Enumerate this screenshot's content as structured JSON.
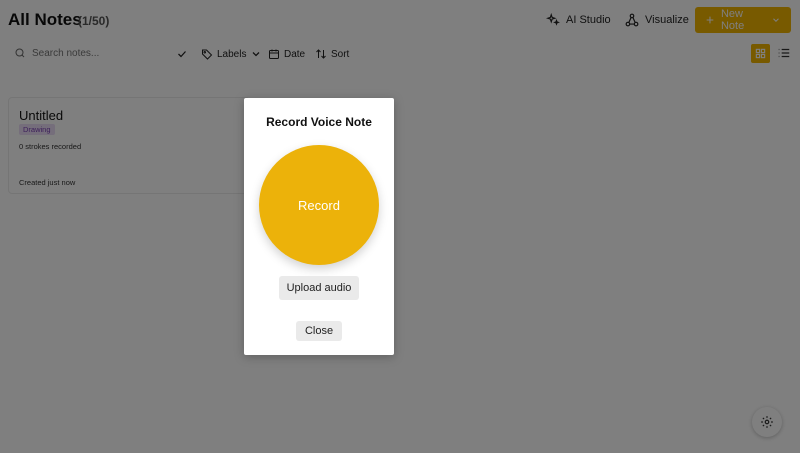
{
  "header": {
    "title": "All Notes",
    "count": "(1/50)",
    "ai_studio_label": "AI Studio",
    "visualize_label": "Visualize",
    "new_note_label": "New Note"
  },
  "toolbar": {
    "search_placeholder": "Search notes...",
    "labels_label": "Labels",
    "date_label": "Date",
    "sort_label": "Sort"
  },
  "notes": [
    {
      "title": "Untitled",
      "badge": "Drawing",
      "meta": "0 strokes recorded",
      "created": "Created just now"
    }
  ],
  "modal": {
    "title": "Record Voice Note",
    "record_label": "Record",
    "upload_label": "Upload audio",
    "close_label": "Close"
  },
  "colors": {
    "accent": "#f0b400",
    "record": "#ecb20a",
    "badge_text": "#7b3fb5",
    "badge_bg": "#eadcf6"
  },
  "icons": {
    "ai_studio": "sparkles-icon",
    "visualize": "network-icon",
    "new_note": "plus-icon",
    "dropdown": "chevron-down-icon",
    "search": "search-icon",
    "check": "check-icon",
    "labels": "tag-icon",
    "date": "calendar-icon",
    "sort": "sort-arrows-icon",
    "grid_view": "grid-icon",
    "list_view": "list-icon",
    "settings": "gear-icon"
  }
}
